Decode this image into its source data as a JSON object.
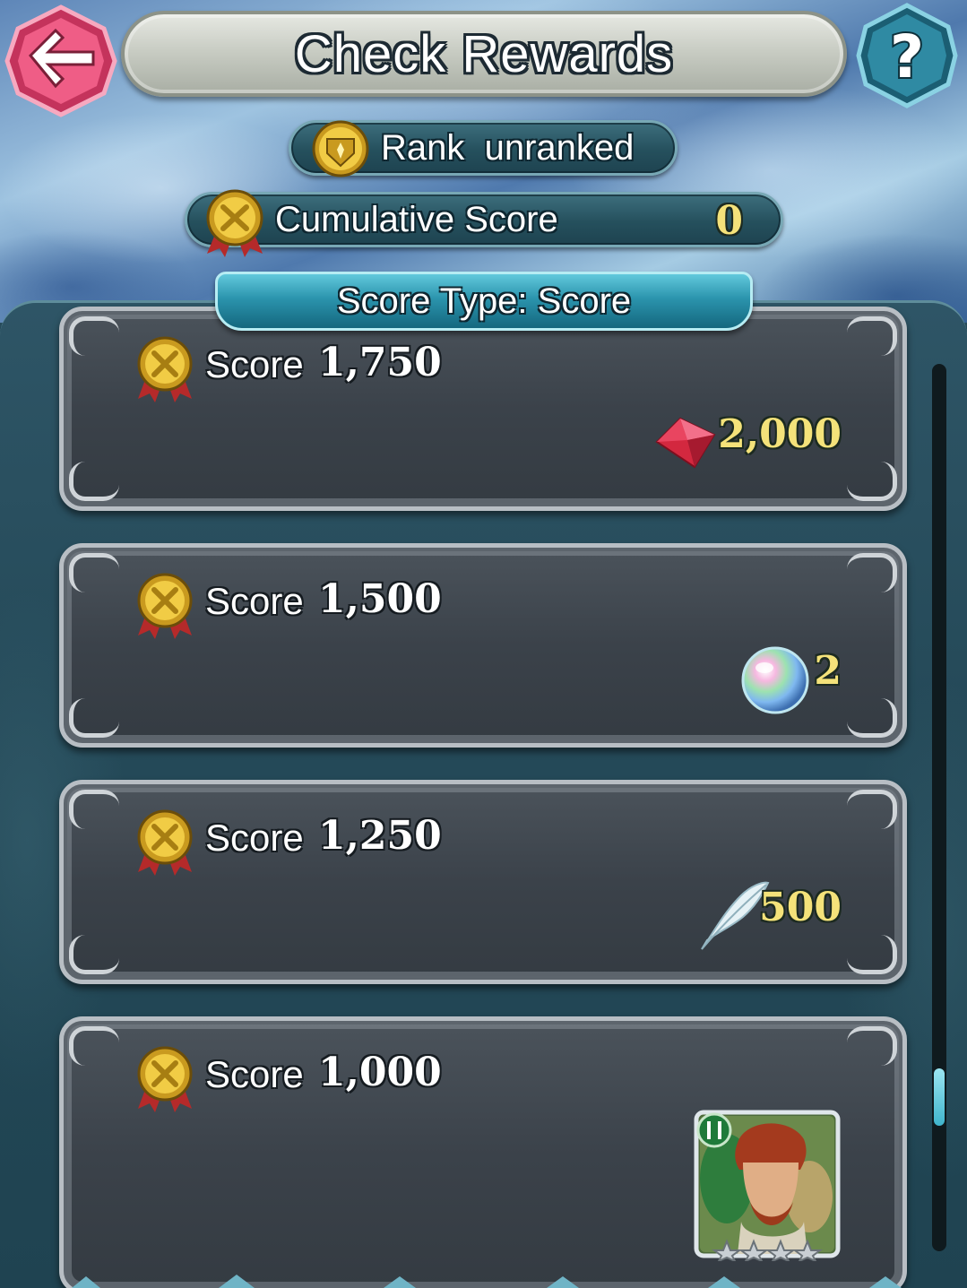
{
  "header": {
    "title": "Check Rewards",
    "back_icon": "back-arrow-icon",
    "help_icon": "question-mark-icon"
  },
  "rank": {
    "label": "Rank  unranked",
    "icon": "rank-crest-icon"
  },
  "cumulative": {
    "label": "Cumulative Score",
    "value": "0",
    "icon": "score-medal-icon"
  },
  "score_type": {
    "label": "Score Type: Score"
  },
  "rewards": [
    {
      "label": "Score",
      "value": "1,750",
      "reward_icon": "orb-gem-icon",
      "amount": "2,000"
    },
    {
      "label": "Score",
      "value": "1,500",
      "reward_icon": "sacred-orb-icon",
      "amount": "2"
    },
    {
      "label": "Score",
      "value": "1,250",
      "reward_icon": "feather-icon",
      "amount": "500"
    },
    {
      "label": "Score",
      "value": "1,000",
      "reward_icon": "hero-portrait-icon",
      "amount": ""
    }
  ],
  "colors": {
    "accent_gold": "#f4e27a",
    "panel_teal": "#25505d",
    "tab_cyan": "#2b94ad",
    "back_pink": "#e84d78"
  },
  "hero_reward": {
    "rarity_stars": 4,
    "weapon_icon": "green-axe-icon"
  }
}
